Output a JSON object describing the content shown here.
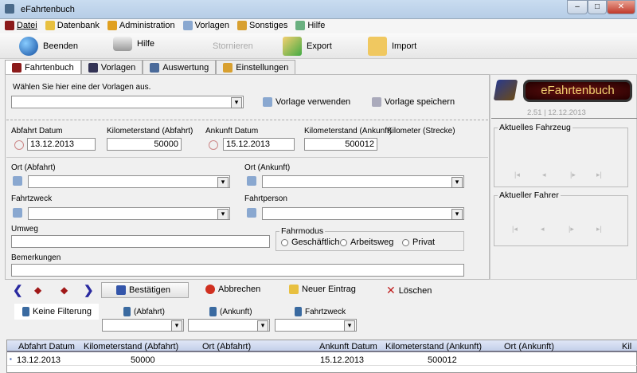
{
  "window": {
    "title": "eFahrtenbuch"
  },
  "menu": [
    "Datei",
    "Datenbank",
    "Administration",
    "Vorlagen",
    "Sonstiges",
    "Hilfe"
  ],
  "toolbar": {
    "exit": "Beenden",
    "help": "Hilfe",
    "cancel": "Stornieren",
    "export": "Export",
    "import": "Import"
  },
  "tabs": [
    "Fahrtenbuch",
    "Vorlagen",
    "Auswertung",
    "Einstellungen"
  ],
  "template": {
    "prompt": "Wählen Sie hier eine der Vorlagen aus.",
    "use": "Vorlage verwenden",
    "save": "Vorlage speichern"
  },
  "fields": {
    "dep_date_label": "Abfahrt Datum",
    "dep_date": "13.12.2013",
    "dep_km_label": "Kilometerstand (Abfahrt)",
    "dep_km": "50000",
    "arr_date_label": "Ankunft Datum",
    "arr_date": "15.12.2013",
    "arr_km_label": "Kilometerstand (Ankunft)",
    "arr_km": "500012",
    "distance_label": "Kilometer (Strecke)",
    "from_label": "Ort (Abfahrt)",
    "to_label": "Ort (Ankunft)",
    "purpose_label": "Fahrtzweck",
    "person_label": "Fahrtperson",
    "detour_label": "Umweg",
    "notes_label": "Bemerkungen",
    "mode_label": "Fahrmodus",
    "modes": [
      "Geschäftlich",
      "Arbeitsweg",
      "Privat"
    ]
  },
  "side": {
    "logo": "eFahrtenbuch",
    "version": "2.51 | 12.12.2013",
    "vehicle": "Aktuelles Fahrzeug",
    "driver": "Aktueller Fahrer"
  },
  "actions": {
    "confirm": "Bestätigen",
    "abort": "Abbrechen",
    "new": "Neuer Eintrag",
    "delete": "Löschen"
  },
  "filters": {
    "none": "Keine Filterung",
    "dep": "(Abfahrt)",
    "arr": "(Ankunft)",
    "purpose": "Fahrtzweck"
  },
  "table": {
    "headers": [
      "Abfahrt Datum",
      "Kilometerstand (Abfahrt)",
      "Ort (Abfahrt)",
      "Ankunft Datum",
      "Kilometerstand (Ankunft)",
      "Ort (Ankunft)",
      "Kil"
    ],
    "rows": [
      [
        "13.12.2013",
        "50000",
        "",
        "15.12.2013",
        "500012",
        ""
      ]
    ]
  },
  "colors": {
    "accent": "#c0392b",
    "nav": "#2a2aa0"
  }
}
